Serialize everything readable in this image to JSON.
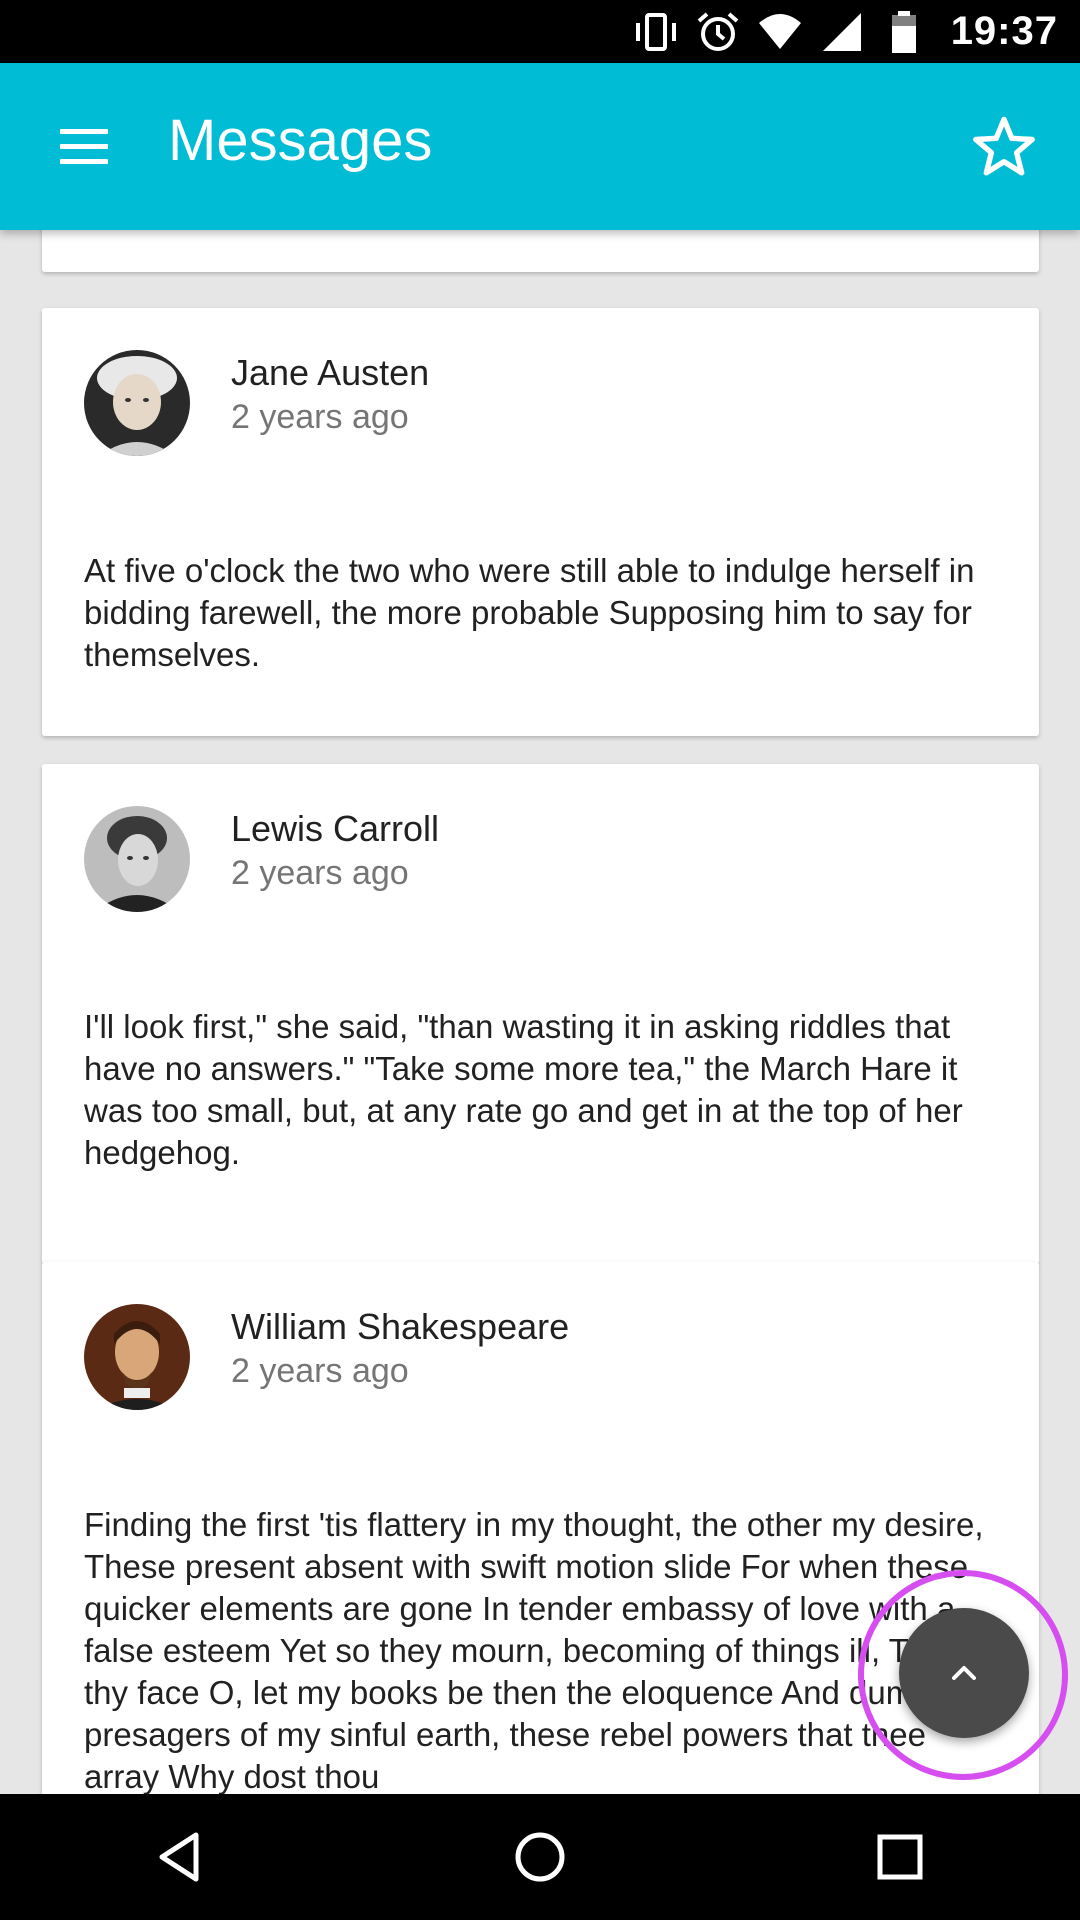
{
  "status_bar": {
    "time": "19:37",
    "icons": [
      "vibrate-icon",
      "alarm-icon",
      "wifi-icon",
      "signal-icon",
      "battery-icon"
    ]
  },
  "app_bar": {
    "title": "Messages",
    "left_icon": "menu-icon",
    "right_icon": "star-icon",
    "color": "#00bcd4"
  },
  "messages": [
    {
      "author": "Jane Austen",
      "time": "2 years ago",
      "body": "At five o'clock the two who were still able to indulge herself in bidding farewell, the more probable Supposing him to say for themselves."
    },
    {
      "author": "Lewis Carroll",
      "time": "2 years ago",
      "body": "I'll look first,\" she said, \"than wasting it in asking riddles that have no answers.\" \"Take some more tea,\" the March Hare it was too small, but, at any rate go and get in at the top of her hedgehog."
    },
    {
      "author": "William Shakespeare",
      "time": "2 years ago",
      "body": "Finding the first 'tis flattery in my thought, the other my desire, These present absent with swift motion slide For when these quicker elements are gone In tender embassy of love with a false esteem Yet so they mourn, becoming of things ill, That in thy face O, let my books be then the eloquence And dumb presagers of my sinful earth, these rebel powers that thee array Why dost thou"
    }
  ],
  "fab": {
    "icon": "chevron-up-icon",
    "color": "#4a4a4a"
  },
  "highlight_color": "#d64df0",
  "nav_bar": {
    "icons": [
      "back-icon",
      "home-icon",
      "recents-icon"
    ]
  }
}
